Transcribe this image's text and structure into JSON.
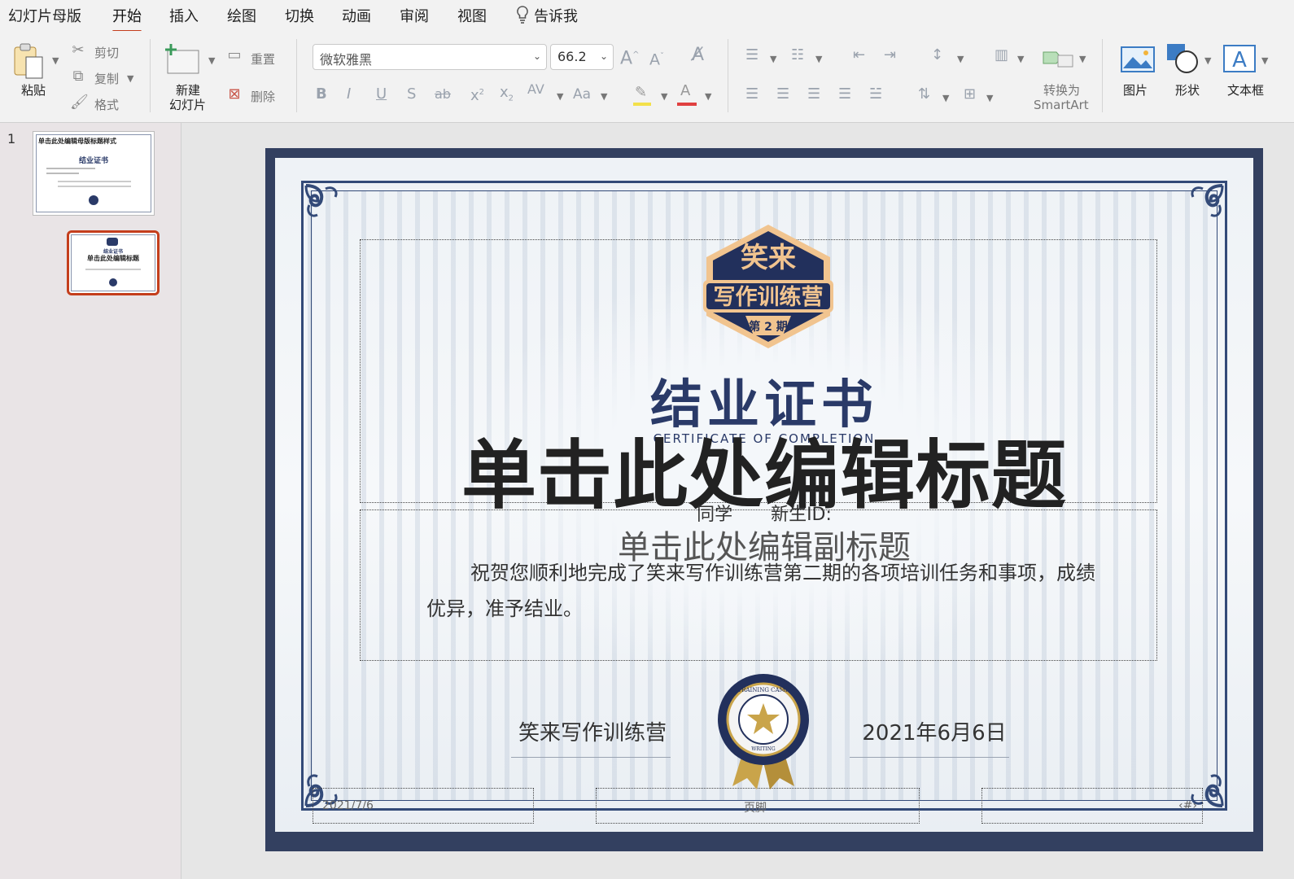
{
  "menu": {
    "tabs": [
      "幻灯片母版",
      "开始",
      "插入",
      "绘图",
      "切换",
      "动画",
      "审阅",
      "视图"
    ],
    "active_tab": "开始",
    "tell_me": "告诉我"
  },
  "ribbon": {
    "paste_label": "粘贴",
    "cut_label": "剪切",
    "copy_label": "复制",
    "format_label": "格式",
    "new_slide_label_1": "新建",
    "new_slide_label_2": "幻灯片",
    "reset_label": "重置",
    "delete_label": "删除",
    "font_name": "微软雅黑",
    "font_size": "66.2",
    "smartart_label_1": "转换为",
    "smartart_label_2": "SmartArt",
    "picture_label": "图片",
    "shape_label": "形状",
    "textbox_label": "文本框"
  },
  "panel": {
    "slide_number": "1",
    "thumb1_title": "单击此处编辑母版标题样式",
    "thumb1_cert": "结业证书",
    "thumb2_cert": "结业证书",
    "thumb2_title": "单击此处编辑标题"
  },
  "slide": {
    "badge_top": "笑来",
    "badge_main": "写作训练营",
    "badge_issue": "第 2 期",
    "cert_title": "结业证书",
    "cert_subtitle": "CERTIFICATE OF COMPLETION",
    "master_title": "单击此处编辑标题",
    "student_line": "同学 新生ID:",
    "master_subtitle": "单击此处编辑副标题",
    "body_text": "祝贺您顺利地完成了笑来写作训练营第二期的各项培训任务和事项，成绩优异，准予结业。",
    "signature_org": "笑来写作训练营",
    "signature_date": "2021年6月6日",
    "seal_ring": "TRAINING CAMP",
    "seal_bottom": "WRITING",
    "footer_date": "2021/7/6",
    "footer_center": "页脚",
    "footer_num": "‹#›"
  },
  "colors": {
    "accent": "#c43e1c",
    "frame": "#334060",
    "title_blue": "#2a3a68",
    "gold": "#c9a44a"
  }
}
